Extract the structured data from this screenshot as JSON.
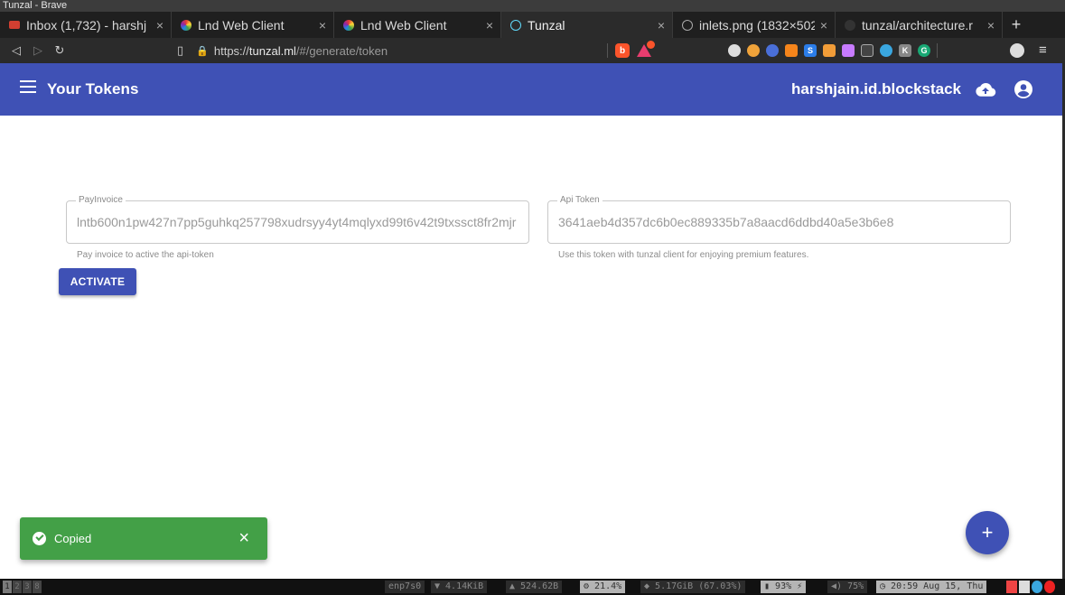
{
  "window_title": "Tunzal - Brave",
  "tabs": [
    {
      "title": "Inbox (1,732) - harshj",
      "icon": "gmail-icon",
      "active": false
    },
    {
      "title": "Lnd Web Client",
      "icon": "lnd-icon",
      "active": false
    },
    {
      "title": "Lnd Web Client",
      "icon": "lnd-icon",
      "active": false
    },
    {
      "title": "Tunzal",
      "icon": "react-icon",
      "active": true
    },
    {
      "title": "inlets.png (1832×502",
      "icon": "globe-icon",
      "active": false
    },
    {
      "title": "tunzal/architecture.r",
      "icon": "github-icon",
      "active": false
    }
  ],
  "tab_close": "×",
  "new_tab": "+",
  "address": {
    "scheme": "https://",
    "host": "tunzal.ml",
    "path": "/#/generate/token"
  },
  "appbar": {
    "title": "Your Tokens",
    "user": "harshjain.id.blockstack",
    "bg_color": "#3f51b5"
  },
  "pay_invoice": {
    "label": "PayInvoice",
    "value": "lntb600n1pw427n7pp5guhkq257798xudrsyy4yt4mqlyxd99t6v42t9txssct8fr2mjr",
    "helper": "Pay invoice to active the api-token"
  },
  "api_token": {
    "label": "Api Token",
    "value": "3641aeb4d357dc6b0ec889335b7a8aacd6ddbd40a5e3b6e8",
    "helper": "Use this token with tunzal client for enjoying premium features."
  },
  "activate_label": "ACTIVATE",
  "snackbar": {
    "message": "Copied",
    "close": "×",
    "color": "#43a047"
  },
  "fab_label": "+",
  "taskbar": {
    "workspaces": [
      "1",
      "2",
      "3",
      "8"
    ],
    "iface": "enp7s0",
    "down": "▼ 4.14KiB",
    "up": "▲ 524.62B",
    "cpu": "21.4%",
    "mem": "5.17GiB (67.03%)",
    "battery": "93%",
    "volume": "75%",
    "clock": "20:59 Aug 15, Thu"
  }
}
